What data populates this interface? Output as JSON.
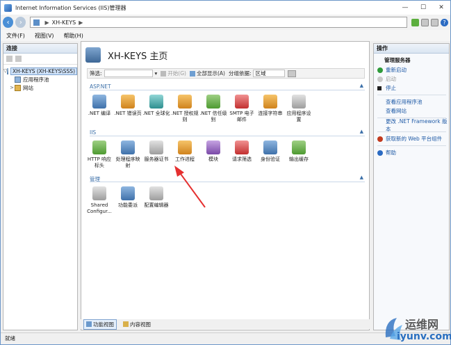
{
  "window": {
    "title": "Internet Information Services (IIS)管理器",
    "controls": [
      "—",
      "☐",
      "✕"
    ]
  },
  "address": {
    "path": [
      "XH-KEYS",
      "▶"
    ]
  },
  "menu": {
    "items": [
      "文件(F)",
      "视图(V)",
      "帮助(H)"
    ]
  },
  "connections": {
    "header": "连接",
    "tree": [
      {
        "label": "XH-KEYS (XH-KEYS\\SSS)",
        "toggle": "▽",
        "selected": true
      },
      {
        "label": "应用程序池",
        "toggle": ""
      },
      {
        "label": "网站",
        "toggle": ">"
      }
    ]
  },
  "home": {
    "title": "XH-KEYS 主页",
    "filter": {
      "label": "筛选:",
      "go": "开始(G)",
      "show_all": "全部显示(A)",
      "group_by_label": "分组依据:",
      "group_by_value": "区域"
    },
    "sections": [
      {
        "name": "ASP.NET",
        "chevron": "▲",
        "features": [
          {
            "label": ".NET 编译"
          },
          {
            "label": ".NET 错误页"
          },
          {
            "label": ".NET 全球化"
          },
          {
            "label": ".NET 授权规则"
          },
          {
            "label": ".NET 信任级别"
          },
          {
            "label": "SMTP 电子邮件"
          },
          {
            "label": "连接字符串"
          },
          {
            "label": "应用程序设置"
          }
        ]
      },
      {
        "name": "IIS",
        "chevron": "▲",
        "features": [
          {
            "label": "HTTP 响应标头"
          },
          {
            "label": "处理程序映射"
          },
          {
            "label": "服务器证书"
          },
          {
            "label": "工作进程"
          },
          {
            "label": "模块"
          },
          {
            "label": "请求筛选"
          },
          {
            "label": "身份验证"
          },
          {
            "label": "输出缓存"
          }
        ]
      },
      {
        "name": "管理",
        "chevron": "▲",
        "features": [
          {
            "label": "Shared Configur..."
          },
          {
            "label": "功能委派"
          },
          {
            "label": "配置编辑器"
          }
        ]
      }
    ]
  },
  "view_tabs": [
    "功能视图",
    "内容视图"
  ],
  "actions": {
    "header": "操作",
    "group_title": "管理服务器",
    "items": [
      {
        "label": "重新启动",
        "state": "link",
        "color": "#2e9b3a"
      },
      {
        "label": "启动",
        "state": "disabled",
        "color": "#a8a8a8"
      },
      {
        "label": "停止",
        "state": "link",
        "color": "#1f1f1f"
      },
      {
        "label": "查看应用程序池",
        "state": "link",
        "color": ""
      },
      {
        "label": "查看网站",
        "state": "link",
        "color": ""
      },
      {
        "label": "更改 .NET Framework 版本",
        "state": "link",
        "color": ""
      },
      {
        "label": "获取新的 Web 平台组件",
        "state": "link",
        "color": "#c23a1e"
      },
      {
        "label": "帮助",
        "state": "link",
        "color": "#2a6ac2"
      }
    ]
  },
  "status": {
    "text": "就绪"
  },
  "watermark": {
    "line1": "运维网",
    "line2": "iyunv.com"
  }
}
